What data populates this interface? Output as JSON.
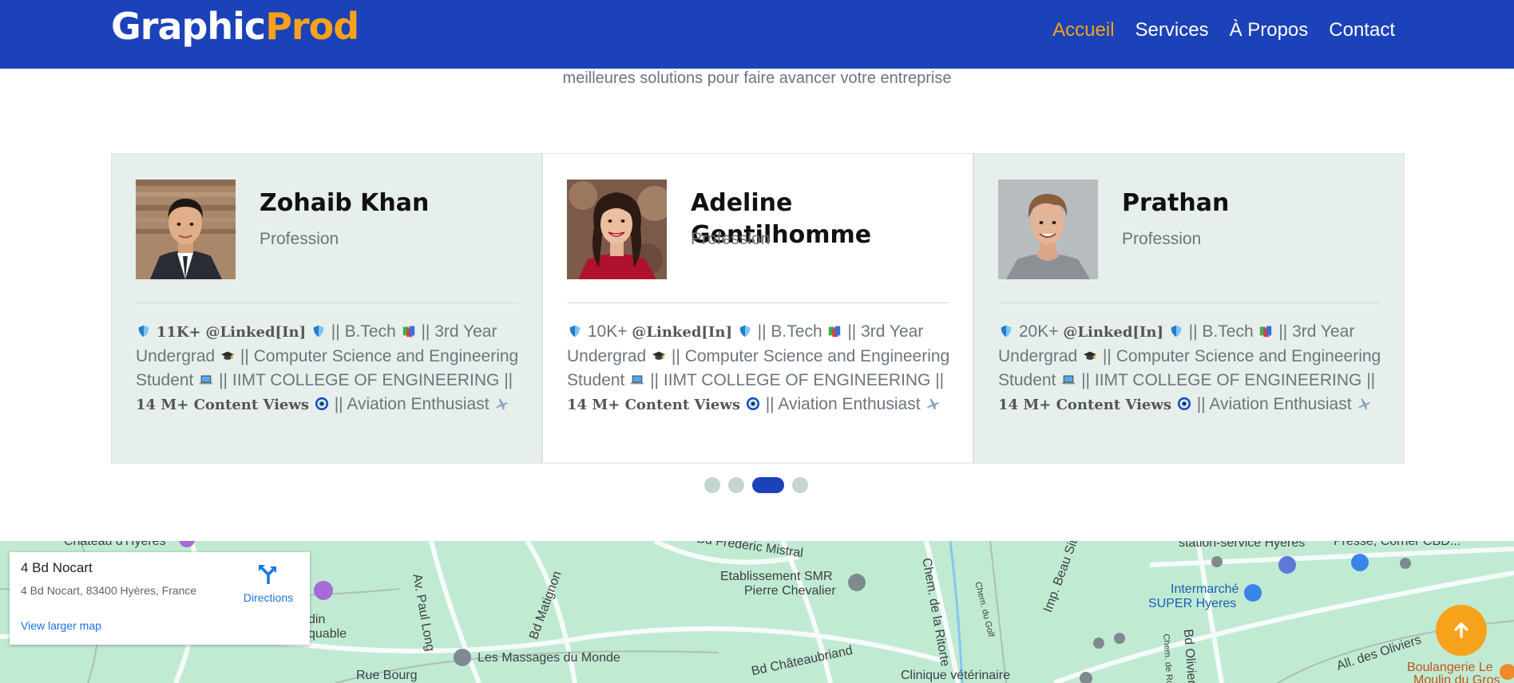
{
  "nav": {
    "brand_part1": "Graphic",
    "brand_part2": "Prod",
    "links": [
      {
        "label": "Accueil",
        "active": true
      },
      {
        "label": "Services"
      },
      {
        "label": "À Propos"
      },
      {
        "label": "Contact"
      }
    ]
  },
  "section": {
    "subtitle": "meilleures solutions pour faire avancer votre entreprise"
  },
  "testimonials": [
    {
      "name": "Zohaib Khan",
      "profession": "Profession",
      "followers": "11K+",
      "handle": "@Linked[In]",
      "education": "B.Tech",
      "year_text": "3rd Year Undergrad",
      "field": "Computer Science and Engineering Student",
      "college": "IIMT COLLEGE OF ENGINEERING",
      "views": "14 M+ Content Views",
      "interest": "Aviation Enthusiast",
      "sep": "||"
    },
    {
      "name": "Adeline Gentilhomme",
      "profession": "Profession",
      "followers": "10K+",
      "handle": "@Linked[In]",
      "education": "B.Tech",
      "year_text": "3rd Year Undergrad",
      "field": "Computer Science and Engineering Student",
      "college": "IIMT COLLEGE OF ENGINEERING",
      "views": "14 M+ Content Views",
      "interest": "Aviation Enthusiast",
      "sep": "||"
    },
    {
      "name": "Prathan",
      "profession": "Profession",
      "followers": "20K+",
      "handle": "@Linked[In]",
      "education": "B.Tech",
      "year_text": "3rd Year Undergrad",
      "field": "Computer Science and Engineering Student",
      "college": "IIMT COLLEGE OF ENGINEERING",
      "views": "14 M+ Content Views",
      "interest": "Aviation Enthusiast",
      "sep": "||"
    }
  ],
  "carousel": {
    "dot_count": 4,
    "active_index": 2
  },
  "map": {
    "place_title": "4 Bd Nocart",
    "place_address": "4 Bd Nocart, 83400 Hyères, France",
    "directions_label": "Directions",
    "view_larger": "View larger map",
    "labels": {
      "chateau": "Château d'Hyères",
      "bd_frederic": "Bd Frédéric Mistral",
      "station": "station-service Hyeres",
      "presse": "Presse, Corner CBD...",
      "etablissement": "Etablissement SMR",
      "pierre": "Pierre Chevalier",
      "intermarche": "Intermarché",
      "super_hyeres": "SUPER Hyeres",
      "jardin": "din",
      "equable": "quable",
      "av_paul_long": "Av. Paul Long",
      "bd_matignon": "Bd Matignon",
      "chem_ritorte": "Chem. de la Ritorte",
      "imp_beau_site": "Imp. Beau Site",
      "massages": "Les Massages du Monde",
      "rue_bourgneuf": "Rue Bourg",
      "bd_chateaubriand": "Bd Châteaubriand",
      "clinique": "Clinique vétérinaire",
      "bd_olivier": "Bd Olivier",
      "all_oliviers": "All. des Oliviers",
      "boulangerie": "Boulangerie Le",
      "moulin": "Moulin du Gros",
      "chem_golf": "Chem. du Golf",
      "chem_ro": "Chem. de Ro"
    }
  },
  "colors": {
    "primary": "#1b42b8",
    "accent": "#f7a21b",
    "card_bg": "#e6efeb",
    "dot_inactive": "#c3d6d0",
    "map_bg": "#c1ead3"
  },
  "icons": {
    "directions": "directions-icon",
    "scroll_top": "arrow-up-icon"
  }
}
